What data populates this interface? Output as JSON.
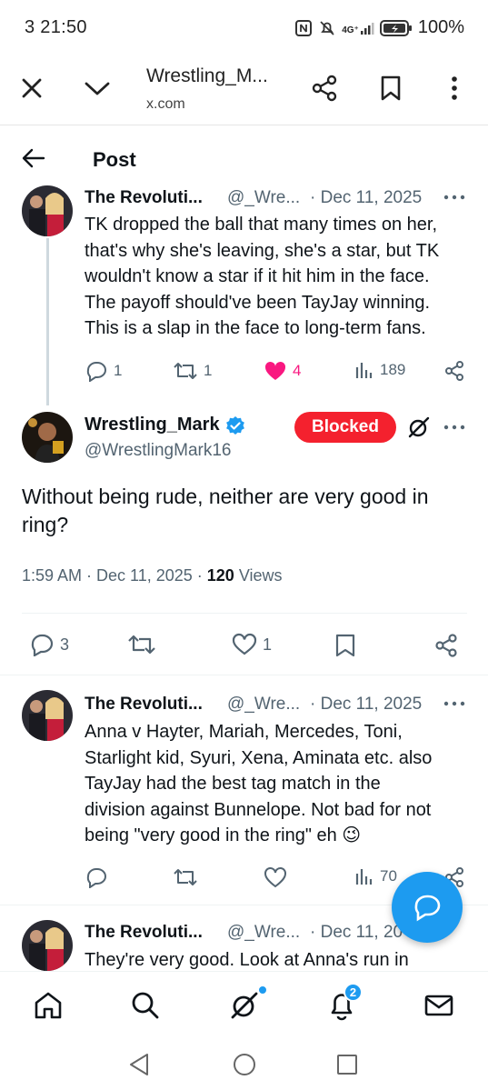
{
  "status_bar": {
    "time": "3 21:50",
    "network": "4G⁺",
    "battery": "100%"
  },
  "browser": {
    "title": "Wrestling_M...",
    "url": "x.com"
  },
  "header": {
    "label": "Post"
  },
  "tweets": [
    {
      "name": "The Revoluti...",
      "handle": "@_Wre...",
      "date": "· Dec 11, 2025",
      "text": [
        "TK dropped the ball that many times on her,",
        "that's why she's leaving, she's a star, but TK",
        "wouldn't know a star if it hit him in the face.",
        "The payoff should've been TayJay winning.",
        "This is a slap in the face to long-term fans."
      ],
      "replies": "1",
      "reposts": "1",
      "likes": "4",
      "views": "189"
    },
    {
      "name": "The Revoluti...",
      "handle": "@_Wre...",
      "date": "· Dec 11, 2025",
      "text": [
        "Anna v Hayter, Mariah, Mercedes, Toni,",
        "Starlight kid, Syuri, Xena, Aminata etc. also",
        "TayJay had the best tag match in the",
        "division against Bunnelope. Not bad for not",
        "being \"very good in the ring\" eh 😉"
      ],
      "views": "70"
    },
    {
      "name": "The Revoluti...",
      "handle": "@_Wre...",
      "date": "· Dec 11, 20",
      "text": [
        "They're very good. Look at Anna's run in"
      ]
    }
  ],
  "main_post": {
    "name": "Wrestling_Mark",
    "handle": "@WrestlingMark16",
    "blocked_label": "Blocked",
    "text": [
      "Without being rude, neither are very good in",
      "ring?"
    ],
    "timestamp": "1:59 AM · Dec 11, 2025 · ",
    "views_count": "120",
    "views_label": " Views",
    "replies": "3",
    "likes": "1"
  },
  "bottom_nav": {
    "notifications_badge": "2"
  },
  "colors": {
    "accent": "#1d9bf0",
    "blocked": "#f4212e",
    "like": "#f91880",
    "text": "#0f1419",
    "muted": "#536471"
  }
}
